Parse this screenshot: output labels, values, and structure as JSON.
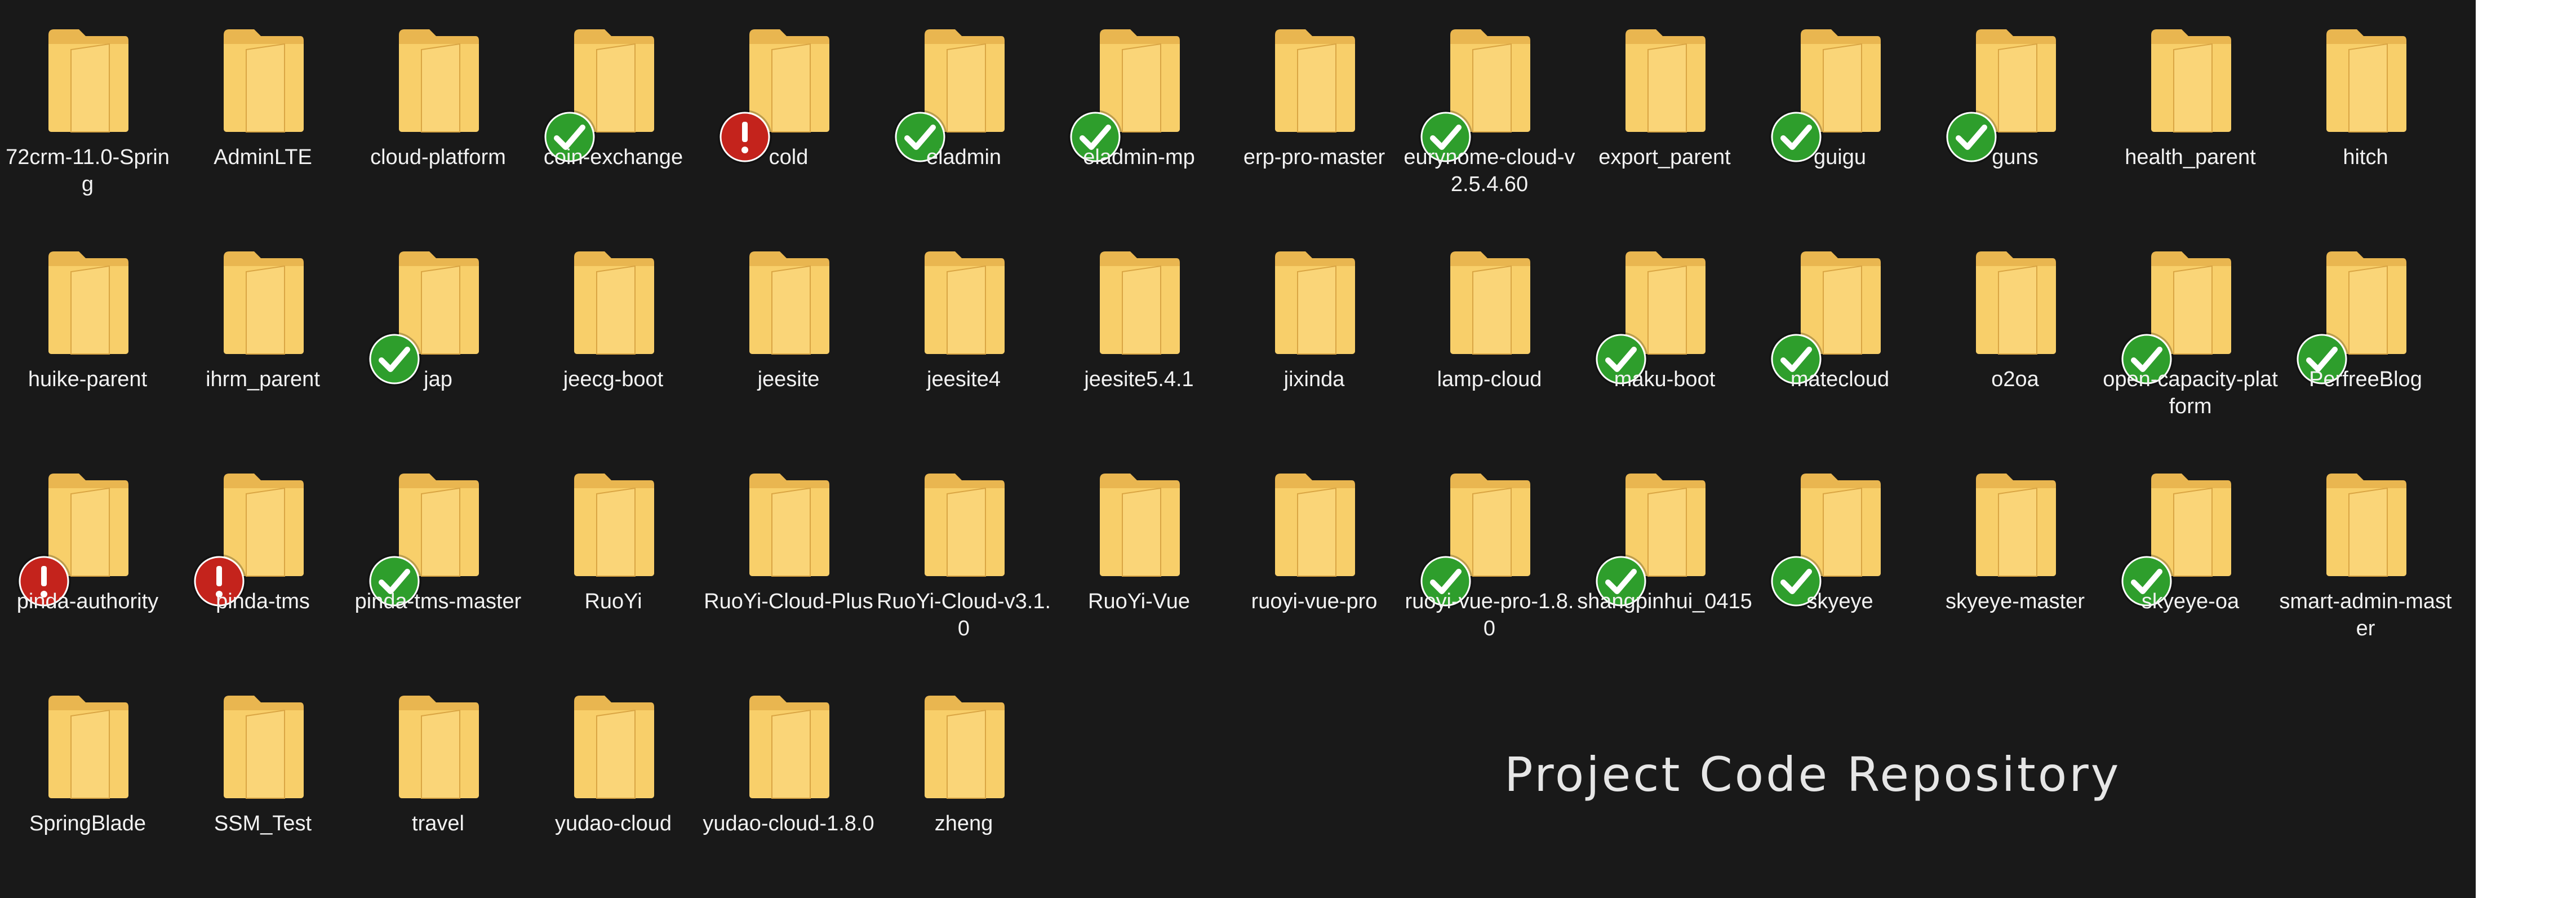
{
  "explorer": {
    "folders": [
      {
        "name": "72crm-11.0-Spring",
        "status": "none"
      },
      {
        "name": "AdminLTE",
        "status": "none"
      },
      {
        "name": "cloud-platform",
        "status": "none"
      },
      {
        "name": "coin-exchange",
        "status": "synced"
      },
      {
        "name": "cold",
        "status": "error"
      },
      {
        "name": "eladmin",
        "status": "synced"
      },
      {
        "name": "eladmin-mp",
        "status": "synced"
      },
      {
        "name": "erp-pro-master",
        "status": "none"
      },
      {
        "name": "eurynome-cloud-v2.5.4.60",
        "status": "synced"
      },
      {
        "name": "export_parent",
        "status": "none"
      },
      {
        "name": "guigu",
        "status": "synced"
      },
      {
        "name": "guns",
        "status": "synced"
      },
      {
        "name": "health_parent",
        "status": "none"
      },
      {
        "name": "hitch",
        "status": "none"
      },
      {
        "name": "huike-parent",
        "status": "none"
      },
      {
        "name": "ihrm_parent",
        "status": "none"
      },
      {
        "name": "jap",
        "status": "synced"
      },
      {
        "name": "jeecg-boot",
        "status": "none"
      },
      {
        "name": "jeesite",
        "status": "none"
      },
      {
        "name": "jeesite4",
        "status": "none"
      },
      {
        "name": "jeesite5.4.1",
        "status": "none"
      },
      {
        "name": "jixinda",
        "status": "none"
      },
      {
        "name": "lamp-cloud",
        "status": "none"
      },
      {
        "name": "maku-boot",
        "status": "synced"
      },
      {
        "name": "matecloud",
        "status": "synced"
      },
      {
        "name": "o2oa",
        "status": "none"
      },
      {
        "name": "open-capacity-platform",
        "status": "synced"
      },
      {
        "name": "PerfreeBlog",
        "status": "synced"
      },
      {
        "name": "pinda-authority",
        "status": "error"
      },
      {
        "name": "pinda-tms",
        "status": "error"
      },
      {
        "name": "pinda-tms-master",
        "status": "synced"
      },
      {
        "name": "RuoYi",
        "status": "none"
      },
      {
        "name": "RuoYi-Cloud-Plus",
        "status": "none"
      },
      {
        "name": "RuoYi-Cloud-v3.1.0",
        "status": "none"
      },
      {
        "name": "RuoYi-Vue",
        "status": "none"
      },
      {
        "name": "ruoyi-vue-pro",
        "status": "none"
      },
      {
        "name": "ruoyi-vue-pro-1.8.0",
        "status": "synced"
      },
      {
        "name": "shangpinhui_0415",
        "status": "synced"
      },
      {
        "name": "skyeye",
        "status": "synced"
      },
      {
        "name": "skyeye-master",
        "status": "none"
      },
      {
        "name": "skyeye-oa",
        "status": "synced"
      },
      {
        "name": "smart-admin-master",
        "status": "none"
      },
      {
        "name": "SpringBlade",
        "status": "none"
      },
      {
        "name": "SSM_Test",
        "status": "none"
      },
      {
        "name": "travel",
        "status": "none"
      },
      {
        "name": "yudao-cloud",
        "status": "none"
      },
      {
        "name": "yudao-cloud-1.8.0",
        "status": "none"
      },
      {
        "name": "zheng",
        "status": "none"
      }
    ],
    "icons": {
      "folder": "folder-icon",
      "synced": "green-check-icon",
      "error": "red-exclamation-icon"
    },
    "colors": {
      "background": "#191919",
      "folder_front": "#F8CF6A",
      "folder_back": "#E9B650",
      "synced_badge": "#2E9E2C",
      "error_badge": "#C4231C",
      "label_text": "#F2F2F2"
    }
  },
  "watermark": {
    "text": "Project Code Repository"
  }
}
